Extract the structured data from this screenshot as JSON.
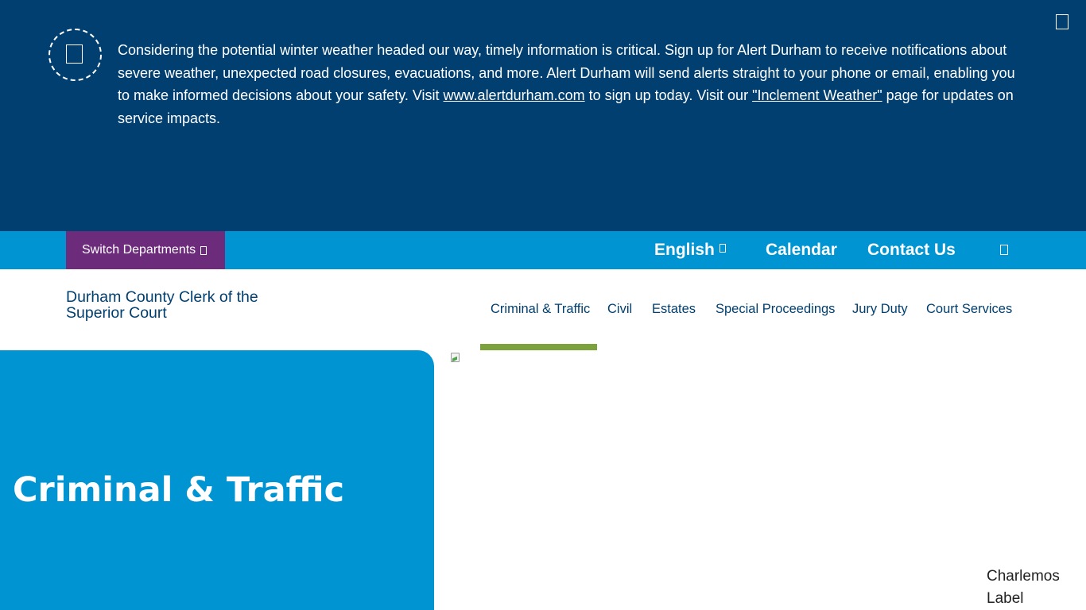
{
  "alert": {
    "text_1": "Considering the potential winter weather headed our way, timely information is critical. Sign up for Alert Durham to receive notifications about severe weather, unexpected road closures, evacuations, and more. Alert Durham will send alerts straight to your phone or email, enabling you to make informed decisions about your safety. Visit ",
    "link_1": "www.alertdurham.com",
    "text_2": " to sign up today. Visit our ",
    "link_2": "\"Inclement Weather\"",
    "text_3": " page for updates on service impacts.",
    "icon": "alert-icon",
    "close_icon": "close-icon"
  },
  "utility": {
    "switch_departments": "Switch Departments",
    "language": "English",
    "calendar": "Calendar",
    "contact": "Contact Us",
    "search_icon": "search-icon"
  },
  "header": {
    "logo_alt": "Durham County Clerk of the Superior Court"
  },
  "nav": {
    "items": [
      {
        "label": "Criminal & Traffic",
        "active": true
      },
      {
        "label": "Civil"
      },
      {
        "label": "Estates"
      },
      {
        "label": "Special Proceedings"
      },
      {
        "label": "Jury Duty"
      },
      {
        "label": "Court Services"
      }
    ]
  },
  "hero": {
    "title": "Criminal & Traffic"
  },
  "widget": {
    "alt": "Charlemos Label"
  },
  "colors": {
    "alert_bg": "#003f6f",
    "utility_bg": "#0094d2",
    "switch_bg": "#6d2b7b",
    "nav_text": "#003f6f",
    "active_bar": "#7ba23b",
    "hero_bg": "#0094d2"
  }
}
